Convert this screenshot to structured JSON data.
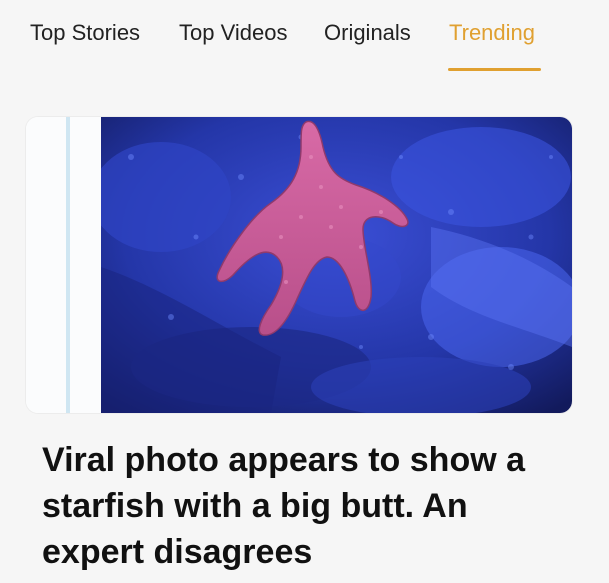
{
  "nav": {
    "tabs": [
      {
        "label": "Top Stories",
        "active": false
      },
      {
        "label": "Top Videos",
        "active": false
      },
      {
        "label": "Originals",
        "active": false
      },
      {
        "label": "Trending",
        "active": true
      }
    ],
    "active_color": "#e0a030"
  },
  "article": {
    "headline": "Viral photo appears to show a starfish with a big butt. An expert disagrees",
    "image_icon": "starfish-photo"
  }
}
